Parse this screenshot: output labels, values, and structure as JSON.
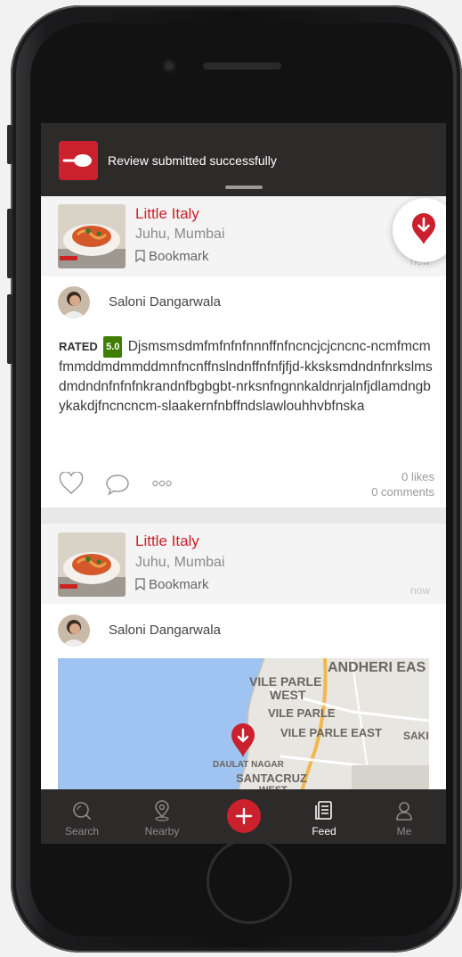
{
  "toast": {
    "message": "Review submitted successfully"
  },
  "posts": [
    {
      "restaurant": {
        "name": "Little Italy",
        "location": "Juhu, Mumbai",
        "bookmark_label": "Bookmark",
        "time": "now"
      },
      "user": {
        "name": "Saloni Dangarwala"
      },
      "rated_label": "RATED",
      "rating": "5.0",
      "review_text": "Djsmsmsdmfmfnfnfnnnffnfncncjcjcncnc-ncmfmcmfmmddmdmmddmnfncnffnslndnffnfnfjfjd-kksksmdndnfnrkslmsdmdndnfnfnfnkrandnfbgbgbt-nrksnfngnnkaldnrjalnfjdlamdngbykakdjfncncncm-slaakernfnbffndslawlouhhvbfnska",
      "likes": "0 likes",
      "comments": "0 comments"
    },
    {
      "restaurant": {
        "name": "Little Italy",
        "location": "Juhu, Mumbai",
        "bookmark_label": "Bookmark",
        "time": "now"
      },
      "user": {
        "name": "Saloni Dangarwala"
      },
      "map_labels": [
        "ANDHERI EAS",
        "VILE PARLE",
        "WEST",
        "VILE PARLE",
        "VILE PARLE EAST",
        "SAKI",
        "DAULAT NAGAR",
        "SANTACRUZ",
        "WEST"
      ]
    }
  ],
  "tabbar": {
    "tabs": [
      {
        "label": "Search",
        "icon": "search-icon"
      },
      {
        "label": "Nearby",
        "icon": "location-pin-icon"
      },
      {
        "label": "",
        "icon": "add-icon"
      },
      {
        "label": "Feed",
        "icon": "feed-icon",
        "active": true
      },
      {
        "label": "Me",
        "icon": "user-icon"
      }
    ]
  },
  "colors": {
    "brand": "#cb202d",
    "rating_green": "#3f7e00",
    "dark_bar": "#2d2a2a"
  }
}
